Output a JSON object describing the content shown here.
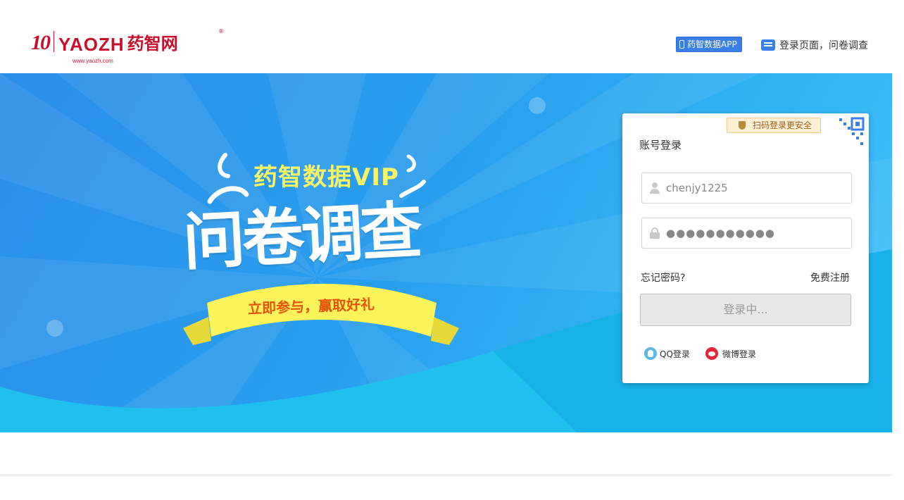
{
  "header": {
    "logo_number": "10",
    "logo_latin": "YAOZH",
    "logo_url": "www.yaozh.com",
    "logo_cn": "药智网",
    "logo_reg": "®",
    "app_button": "药智数据APP",
    "survey_link": "登录页面，问卷调查"
  },
  "banner": {
    "vip_title": "药智数据VIP",
    "main_title": "问卷调查",
    "subtitle": "立即参与，赢取好礼"
  },
  "login": {
    "qr_badge": "扫码登录更安全",
    "title": "账号登录",
    "username_value": "chenjy1225",
    "password_mask": "●●●●●●●●●●●",
    "forgot_password": "忘记密码?",
    "register": "免费注册",
    "submit_label": "登录中...",
    "qq_login": "QQ登录",
    "weibo_login": "微博登录"
  },
  "colors": {
    "brand_red": "#c8102e",
    "accent_blue": "#3a7fe8",
    "banner_blue": "#2a9eee",
    "promo_yellow": "#f7f565",
    "promo_orange": "#e8540c"
  },
  "icons": [
    "phone-icon",
    "chat-icon",
    "shield-icon",
    "qr-code-icon",
    "user-icon",
    "lock-icon",
    "qq-icon",
    "weibo-icon"
  ]
}
